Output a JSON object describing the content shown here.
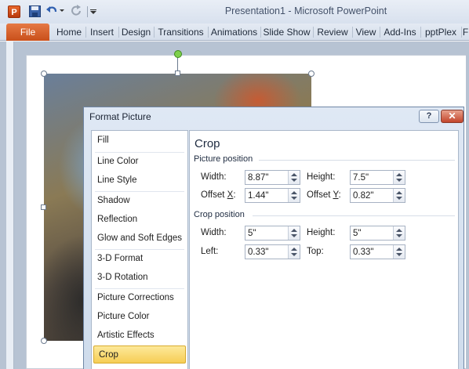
{
  "app": {
    "window_title": "Presentation1  -  Microsoft PowerPoint",
    "icon_letter": "P"
  },
  "ribbon": {
    "file_tab": "File",
    "tabs": [
      "Home",
      "Insert",
      "Design",
      "Transitions",
      "Animations",
      "Slide Show",
      "Review",
      "View",
      "Add-Ins",
      "pptPlex",
      "F"
    ]
  },
  "dialog": {
    "title": "Format Picture",
    "help_label": "?",
    "close_label": "✕",
    "categories": [
      "Fill",
      "Line Color",
      "Line Style",
      "Shadow",
      "Reflection",
      "Glow and Soft Edges",
      "3-D Format",
      "3-D Rotation",
      "Picture Corrections",
      "Picture Color",
      "Artistic Effects",
      "Crop"
    ],
    "selected_category": "Crop",
    "section_title": "Crop",
    "picture_position": {
      "label": "Picture position",
      "width_label": "Width:",
      "width": "8.87\"",
      "height_label": "Height:",
      "height": "7.5\"",
      "offset_x_label_pre": "Offset ",
      "offset_x_label_key": "X",
      "offset_x_label_post": ":",
      "offset_x": "1.44\"",
      "offset_y_label_pre": "Offset ",
      "offset_y_label_key": "Y",
      "offset_y_label_post": ":",
      "offset_y": "0.82\""
    },
    "crop_position": {
      "label": "Crop position",
      "width_label": "Width:",
      "width": "5\"",
      "height_label": "Height:",
      "height": "5\"",
      "left_label": "Left:",
      "left": "0.33\"",
      "top_label": "Top:",
      "top": "0.33\""
    }
  }
}
